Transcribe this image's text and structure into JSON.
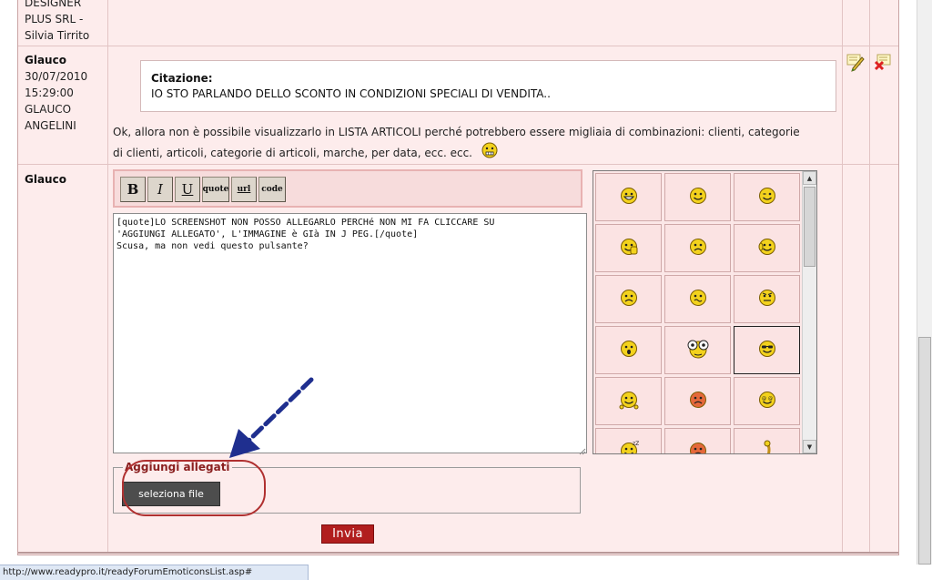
{
  "previous_post": {
    "author_lines": [
      "DESIGNER",
      "PLUS SRL -",
      "Silvia Tirrito"
    ]
  },
  "post": {
    "author": "Glauco",
    "date": "30/07/2010",
    "time": "15:29:00",
    "full_name_line1": "GLAUCO",
    "full_name_line2": "ANGELINI",
    "quote_title": "Citazione:",
    "quote_text": "IO STO PARLANDO DELLO SCONTO IN CONDIZIONI SPECIALI DI VENDITA..",
    "body_line1": "Ok, allora non è possibile visualizzarlo in LISTA ARTICOLI perché potrebbero essere migliaia di combinazioni: clienti, categorie",
    "body_line2": "di clienti, articoli, categorie di articoli, marche, per data, ecc. ecc.",
    "edit_icon": "edit-pencil-icon",
    "delete_icon": "delete-x-icon"
  },
  "reply": {
    "author": "Glauco",
    "toolbar": {
      "bold": "B",
      "italic": "I",
      "underline": "U",
      "quote": "quote",
      "url": "url",
      "code": "code"
    },
    "message": "[quote]LO SCREENSHOT NON POSSO ALLEGARLO PERCHé NON MI FA CLICCARE SU\n'AGGIUNGI ALLEGATO', L'IMMAGINE è GIà IN J PEG.[/quote]\nScusa, ma non vedi questo pulsante?",
    "emoticons": [
      "grin",
      "smile",
      "wink",
      "thumbs-up",
      "sad",
      "ear-wink",
      "pout",
      "unsure",
      "angry",
      "surprised",
      "big-eyes",
      "cool",
      "sleepy-hands",
      "mad-red",
      "dizzy",
      "sleeping",
      "angry-red",
      "worm"
    ],
    "attachments_legend": "Aggiungi allegati",
    "select_file_label": "seleziona file",
    "send_label": "Invia"
  },
  "status_bar": {
    "url": "http://www.readypro.it/readyForumEmoticonsList.asp#"
  },
  "colors": {
    "panel_bg": "#fdecec",
    "accent_red": "#b11e1e",
    "annotation_arrow": "#1f2f8f",
    "annotation_oval": "#b03030"
  }
}
